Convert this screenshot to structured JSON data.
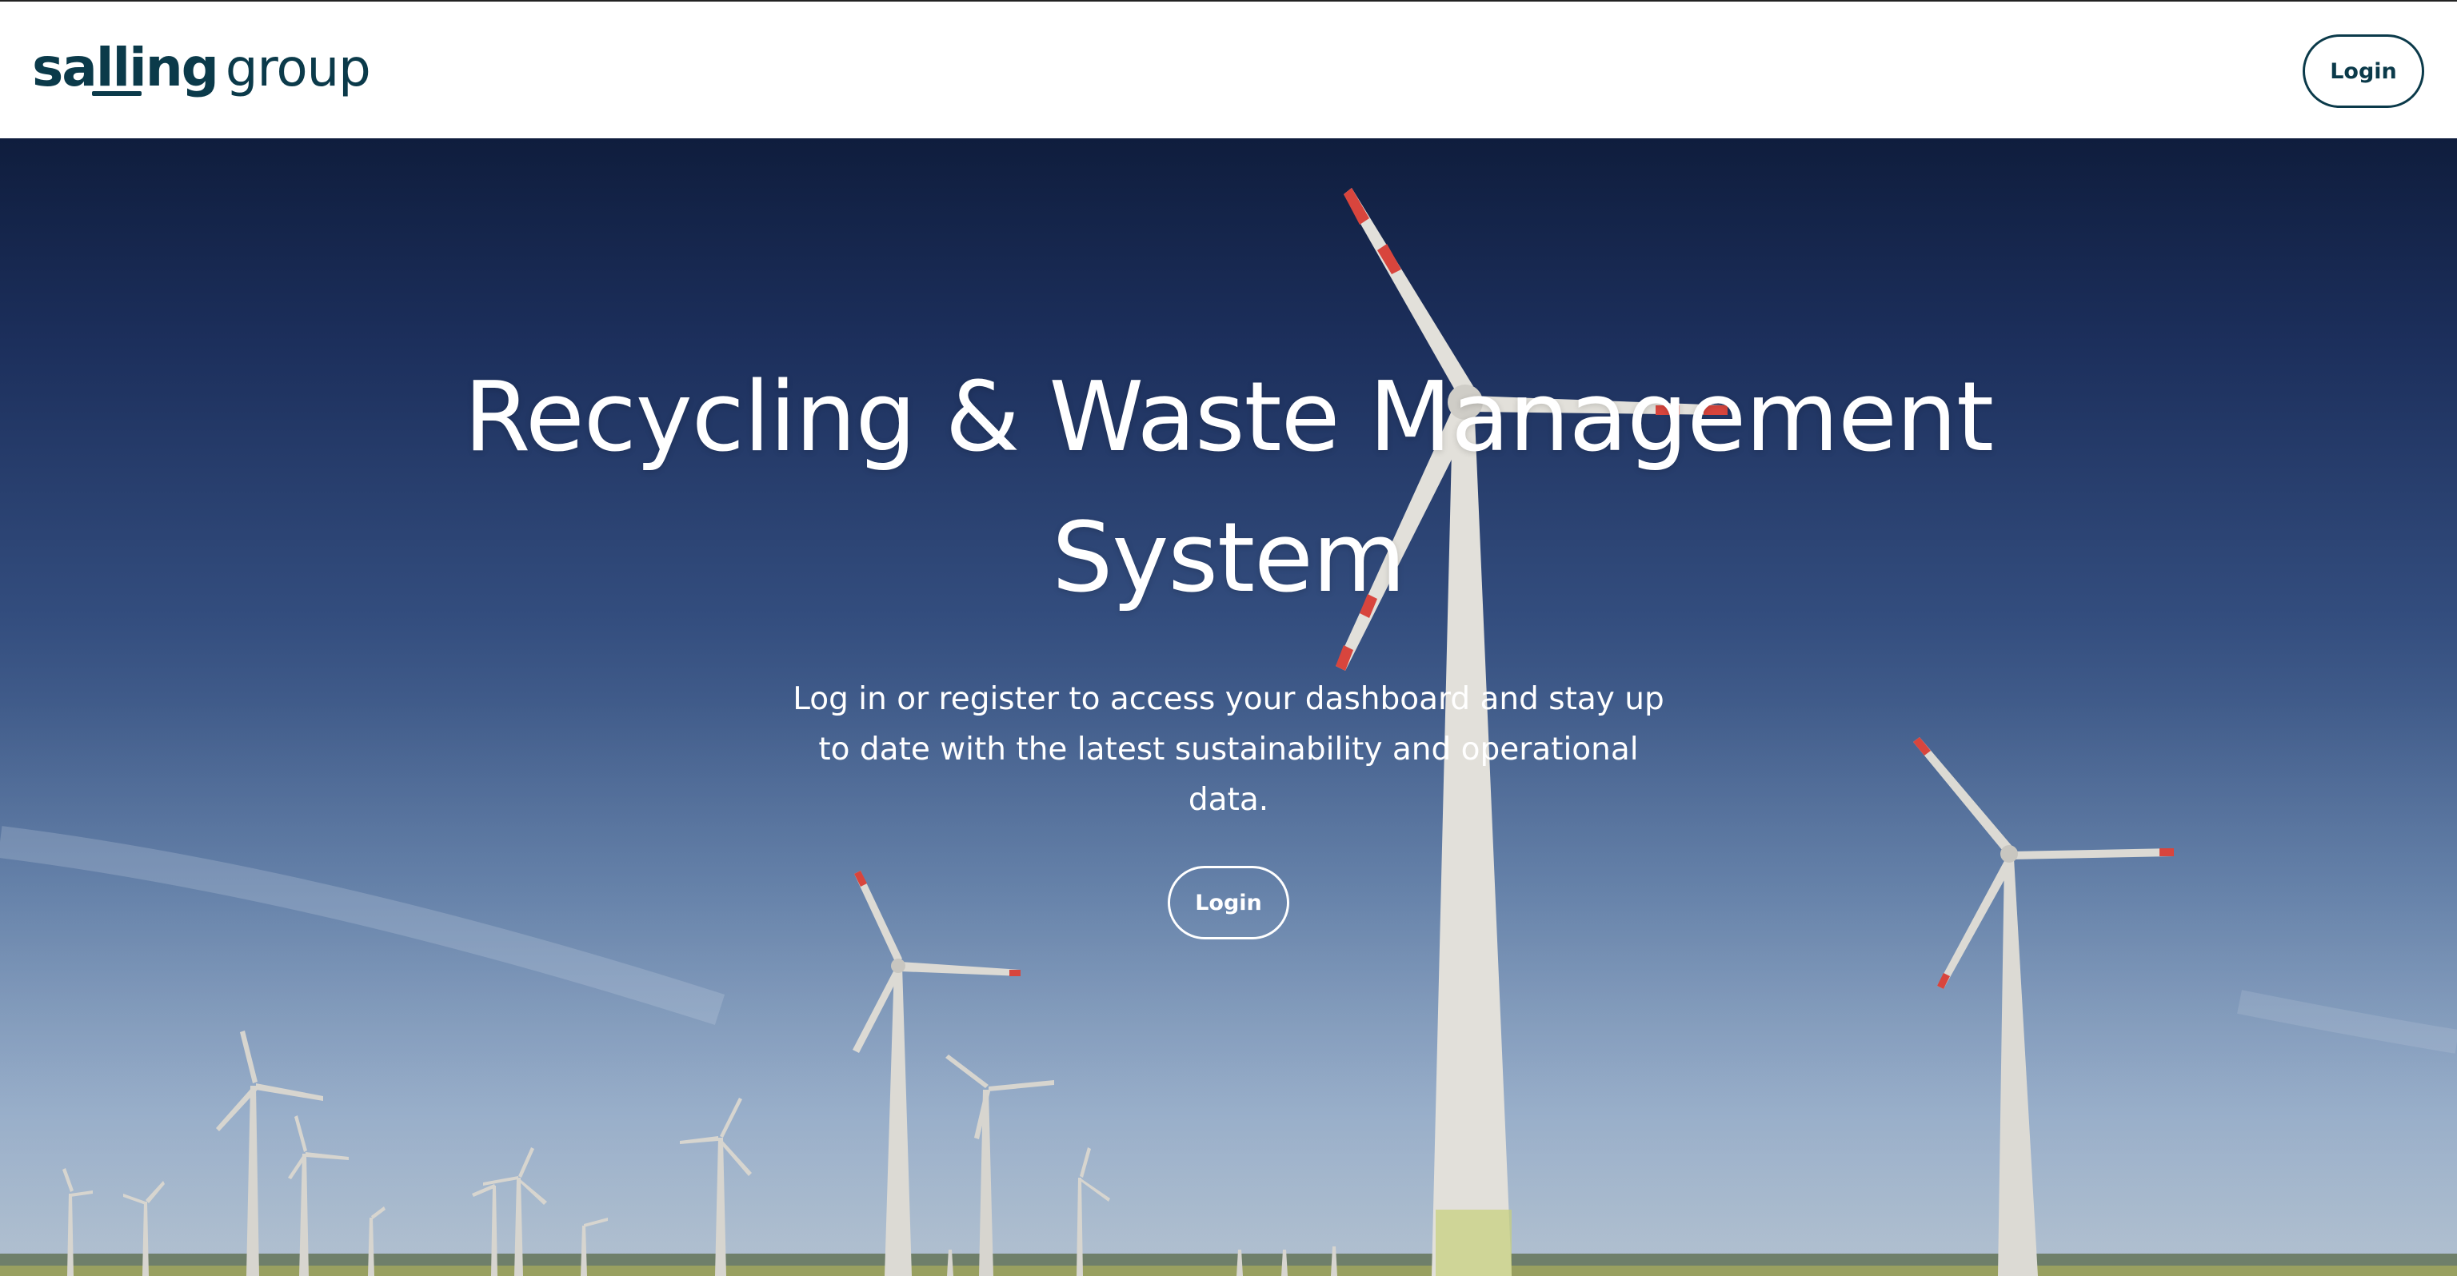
{
  "header": {
    "logo_bold": "salling",
    "logo_light": "group",
    "login_label": "Login"
  },
  "hero": {
    "title_line1": "Recycling & Waste Management",
    "title_line2": "System",
    "subtitle": "Log in or register to access your dashboard and stay up to date with the latest sustainability and operational data.",
    "login_label": "Login",
    "background_image": "wind-turbines-field"
  },
  "colors": {
    "brand": "#0b3a4a",
    "header_bg": "#ffffff",
    "hero_text": "#ffffff",
    "sky_top": "#0f1d3d",
    "sky_bottom": "#a2b4c6"
  }
}
